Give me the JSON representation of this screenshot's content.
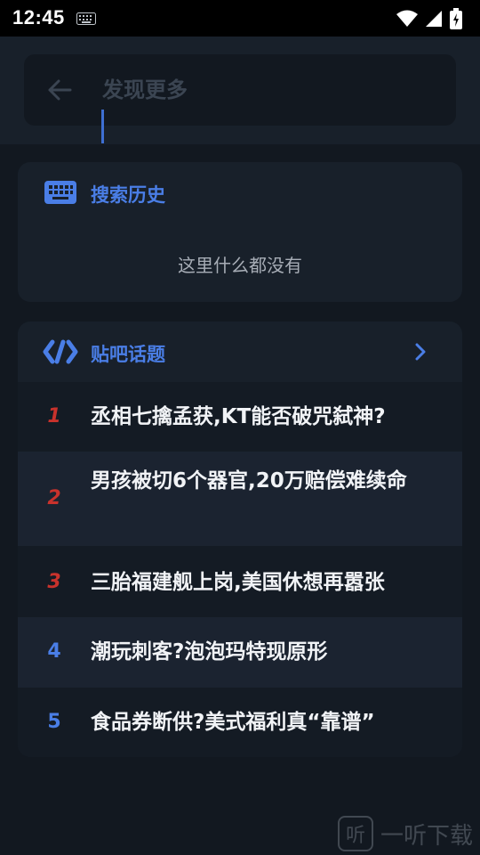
{
  "status_bar": {
    "time": "12:45"
  },
  "search": {
    "placeholder": "发现更多",
    "value": ""
  },
  "history": {
    "title": "搜索历史",
    "empty_text": "这里什么都没有"
  },
  "topics": {
    "title": "贴吧话题",
    "items": [
      {
        "rank": "1",
        "text": "丞相七擒孟获,KT能否破咒弑神?"
      },
      {
        "rank": "2",
        "text": "男孩被切6个器官,20万赔偿难续命"
      },
      {
        "rank": "3",
        "text": "三胎福建舰上岗,美国休想再嚣张"
      },
      {
        "rank": "4",
        "text": "潮玩刺客?泡泡玛特现原形"
      },
      {
        "rank": "5",
        "text": "食品券断供?美式福利真“靠谱”"
      }
    ]
  },
  "watermark": {
    "icon_text": "听",
    "text": "一听下载"
  },
  "colors": {
    "accent": "#4a7ee6",
    "hot_rank": "#c8322c",
    "background": "#121820",
    "card": "#18202a"
  }
}
